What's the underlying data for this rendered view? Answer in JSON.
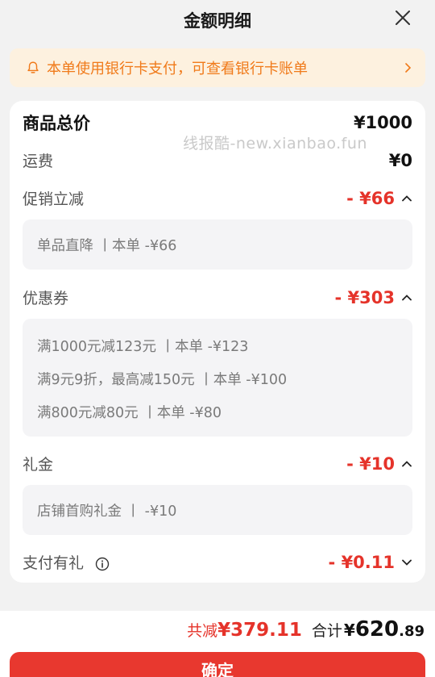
{
  "header": {
    "title": "金额明细"
  },
  "notice": {
    "text": "本单使用银行卡支付，可查看银行卡账单"
  },
  "watermark": "线报酷-new.xianbao.fun",
  "summary": {
    "goods_total_label": "商品总价",
    "goods_total_value": "¥1000",
    "shipping_label": "运费",
    "shipping_value": "¥0"
  },
  "promotion": {
    "label": "促销立减",
    "value": "- ¥66",
    "details": [
      "单品直降 丨本单 -¥66"
    ]
  },
  "coupon": {
    "label": "优惠券",
    "value": "- ¥303",
    "details": [
      "满1000元减123元 丨本单 -¥123",
      "满9元9折，最高减150元 丨本单 -¥100",
      "满800元减80元 丨本单 -¥80"
    ]
  },
  "gift": {
    "label": "礼金",
    "value": "- ¥10",
    "details": [
      "店铺首购礼金 丨 -¥10"
    ]
  },
  "payment_gift": {
    "label": "支付有礼",
    "value": "- ¥0.11"
  },
  "footer": {
    "discount_label": "共减",
    "discount_value": "¥379.11",
    "total_label": "合计",
    "total_currency": "¥",
    "total_integer": "620",
    "total_decimal": ".89",
    "confirm_label": "确定"
  },
  "colors": {
    "accent_red": "#e5332a",
    "notice_orange": "#f07a1a",
    "notice_bg": "#fdf1df"
  }
}
